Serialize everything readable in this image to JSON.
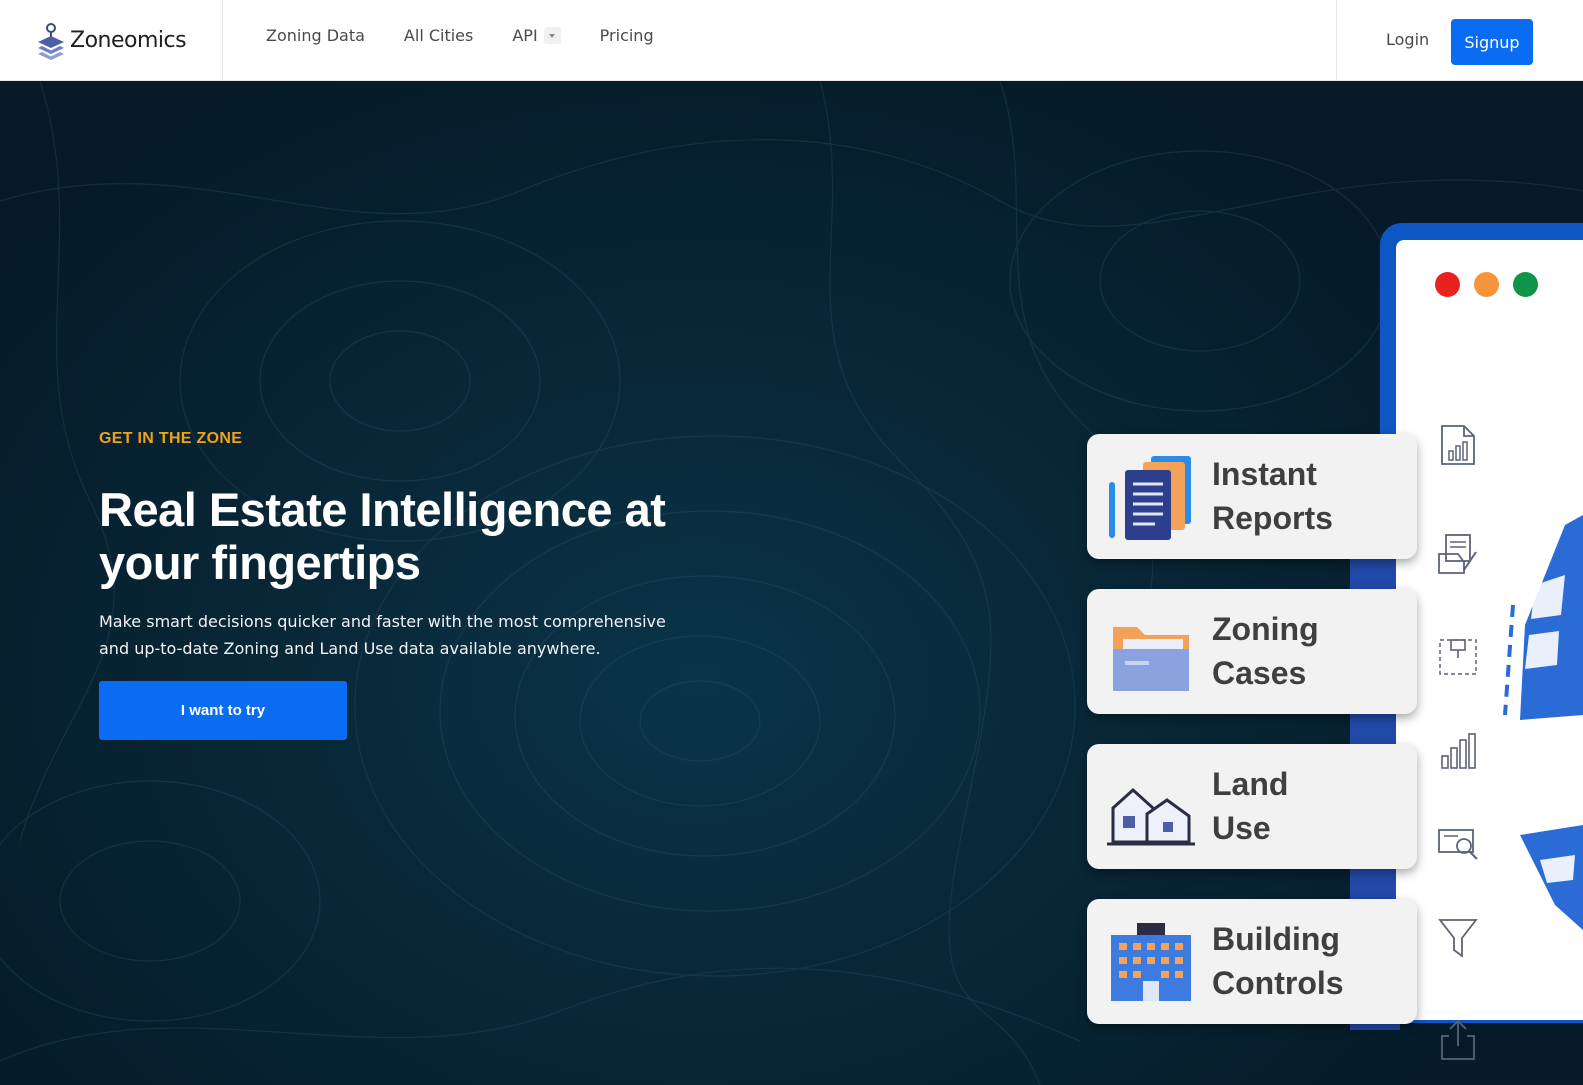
{
  "header": {
    "brand": "Zoneomics",
    "nav": [
      {
        "label": "Zoning Data"
      },
      {
        "label": "All Cities"
      },
      {
        "label": "API"
      },
      {
        "label": "Pricing"
      }
    ],
    "login": "Login",
    "signup": "Signup"
  },
  "hero": {
    "eyebrow": "GET IN THE ZONE",
    "headline": "Real Estate Intelligence at your fingertips",
    "subtext": "Make smart decisions quicker and faster with the most comprehensive and up-to-date Zoning and Land Use data available anywhere.",
    "cta": "I want to try"
  },
  "illustration": {
    "window_dots": [
      "#e8231f",
      "#f5943a",
      "#109448"
    ],
    "cards": [
      {
        "label": "Instant\nReports",
        "icon": "report-documents-icon"
      },
      {
        "label": "Zoning\nCases",
        "icon": "folder-icon"
      },
      {
        "label": "Land\nUse",
        "icon": "houses-icon"
      },
      {
        "label": "Building\nControls",
        "icon": "office-building-icon"
      }
    ],
    "side_icons": [
      "document-chart-icon",
      "document-sign-icon",
      "map-pin-selection-icon",
      "bar-chart-icon",
      "search-map-icon",
      "funnel-filter-icon",
      "share-export-icon"
    ]
  },
  "colors": {
    "accent": "#0a6cf2",
    "eyebrow": "#f0a21b",
    "hero_bg": "#082838"
  }
}
